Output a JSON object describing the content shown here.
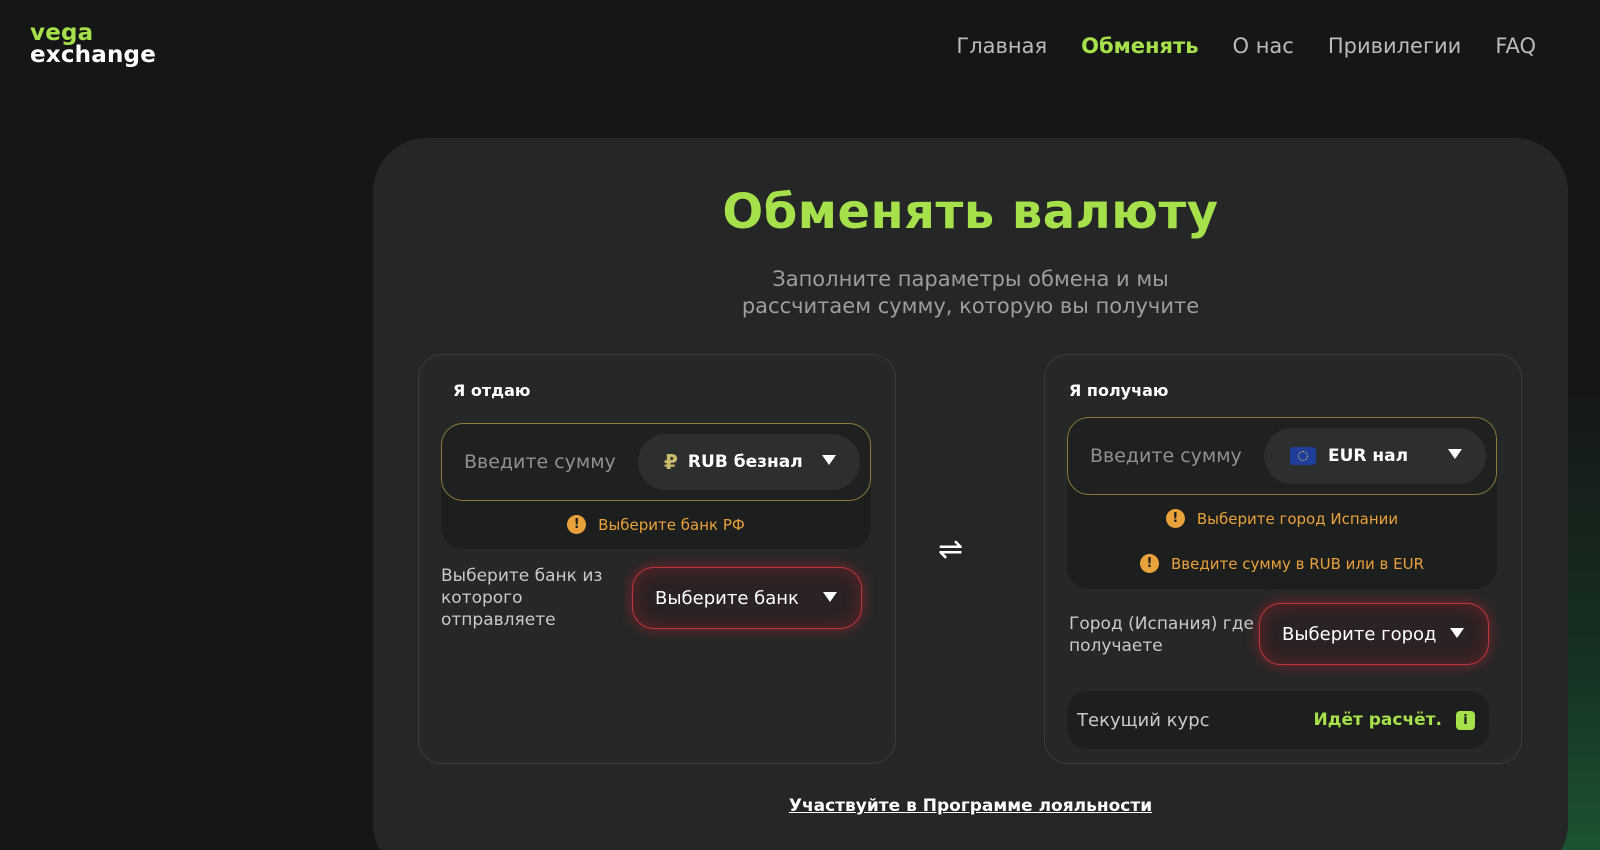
{
  "brand": {
    "line1": "vega",
    "line2": "exchange"
  },
  "nav": [
    {
      "label": "Главная",
      "active": false
    },
    {
      "label": "Обменять",
      "active": true
    },
    {
      "label": "О нас",
      "active": false
    },
    {
      "label": "Привилегии",
      "active": false
    },
    {
      "label": "FAQ",
      "active": false
    }
  ],
  "main": {
    "title": "Обменять валюту",
    "subtitle_line1": "Заполните параметры обмена и мы",
    "subtitle_line2": "рассчитаем сумму, которую вы получите",
    "loyalty_link": "Участвуйте в Программе лояльности"
  },
  "give": {
    "label": "Я отдаю",
    "amount_placeholder": "Введите сумму",
    "currency_symbol": "₽",
    "currency": "RUB безнал",
    "warning": "Выберите банк РФ",
    "bank_label": "Выберите банк из которого отправляете",
    "bank_select": "Выберите банк"
  },
  "receive": {
    "label": "Я получаю",
    "amount_placeholder": "Введите сумму",
    "currency": "EUR нал",
    "warning1": "Выберите город Испании",
    "warning2": "Введите сумму в RUB или в EUR",
    "city_label": "Город (Испания) где получаете",
    "city_select": "Выберите город",
    "rate_label": "Текущий курс",
    "rate_status": "Идёт расчёт."
  },
  "icons": {
    "swap": "⇌",
    "warning": "!",
    "info": "i"
  },
  "colors": {
    "accent": "#a6e04a",
    "warning": "#e9a23b",
    "error": "#c2343d",
    "background": "#151716",
    "card": "#252626"
  }
}
